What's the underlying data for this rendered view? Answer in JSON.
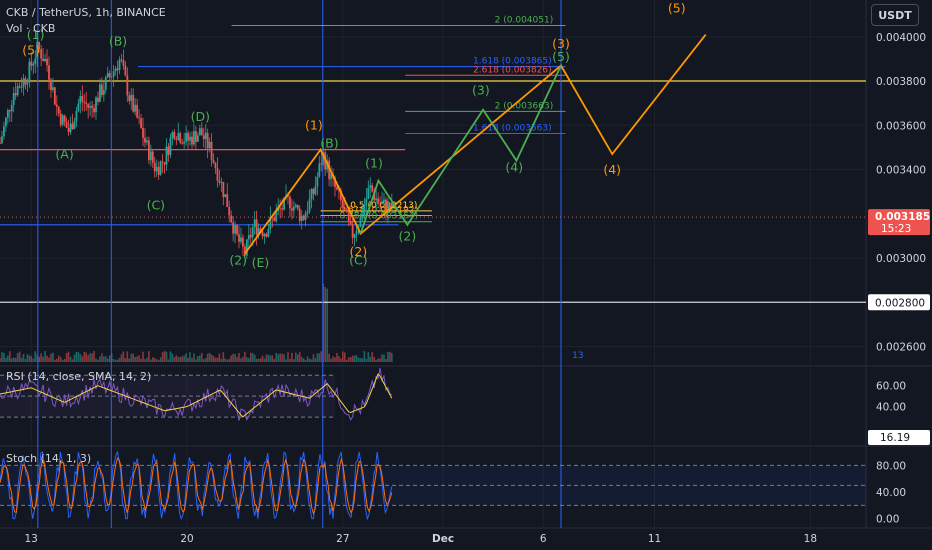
{
  "header": {
    "symbol": "CKB / TetherUS, 1h, BINANCE",
    "volume": "Vol · CKB",
    "rsi": "RSI (14, close, SMA, 14, 2)",
    "stoch": "Stoch (14, 1, 3)"
  },
  "currency_button": "USDT",
  "colors": {
    "bg": "#131722",
    "grid": "#1e222d",
    "text": "#d1d4dc",
    "up": "#26a69a",
    "down": "#ef5350",
    "green_wave": "#4caf50",
    "orange_wave": "#ff9800",
    "blue": "#2962ff",
    "red": "#ef5350",
    "yellow": "#f5d442",
    "rsi": "#7e57c2",
    "rsi_ma": "#f5d442",
    "stoch_k": "#2962ff",
    "stoch_d": "#ff6d00"
  },
  "price_labels": [
    {
      "text": "0.004000",
      "value": 0.004
    },
    {
      "text": "0.003800",
      "value": 0.0038
    },
    {
      "text": "0.003600",
      "value": 0.0036
    },
    {
      "text": "0.003400",
      "value": 0.0034
    },
    {
      "text": "0.003000",
      "value": 0.003
    },
    {
      "text": "0.002600",
      "value": 0.0026
    }
  ],
  "current_price": {
    "value": 0.003185,
    "text": "0.003185",
    "countdown": "15:23"
  },
  "marked_price": {
    "value": 0.0028,
    "text": "0.002800"
  },
  "time_labels": [
    {
      "text": "13",
      "day": 13
    },
    {
      "text": "20",
      "day": 20
    },
    {
      "text": "27",
      "day": 27
    },
    {
      "text": "Dec",
      "day": 31.5
    },
    {
      "text": "6",
      "day": 36
    },
    {
      "text": "11",
      "day": 41
    },
    {
      "text": "18",
      "day": 48
    }
  ],
  "rsi_labels": [
    "60.00",
    "40.00",
    "20.00"
  ],
  "rsi_value": "16.19",
  "stoch_labels": [
    "80.00",
    "40.00",
    "0.00"
  ],
  "chart_data": {
    "type": "line",
    "title": "CKB / TetherUS, 1h, BINANCE",
    "x_unit": "day of month (Nov, continuing into Dec)",
    "xlim": [
      11.6,
      50.5
    ],
    "ylim": [
      0.00253,
      0.00413
    ],
    "price_path": [
      [
        11.6,
        0.00352
      ],
      [
        12.2,
        0.00375
      ],
      [
        12.8,
        0.00382
      ],
      [
        13.3,
        0.00395
      ],
      [
        13.7,
        0.00388
      ],
      [
        14.2,
        0.00366
      ],
      [
        14.7,
        0.00357
      ],
      [
        15.2,
        0.00372
      ],
      [
        15.7,
        0.00367
      ],
      [
        16.1,
        0.00375
      ],
      [
        16.6,
        0.00383
      ],
      [
        17.0,
        0.0039
      ],
      [
        17.4,
        0.00373
      ],
      [
        17.8,
        0.00362
      ],
      [
        18.2,
        0.0035
      ],
      [
        18.6,
        0.0034
      ],
      [
        19.0,
        0.00345
      ],
      [
        19.4,
        0.00358
      ],
      [
        20.0,
        0.00353
      ],
      [
        20.6,
        0.00357
      ],
      [
        21.0,
        0.0035
      ],
      [
        21.4,
        0.00338
      ],
      [
        21.8,
        0.00325
      ],
      [
        22.2,
        0.0031
      ],
      [
        22.6,
        0.00302
      ],
      [
        23.0,
        0.00315
      ],
      [
        23.5,
        0.00312
      ],
      [
        24.0,
        0.0032
      ],
      [
        24.6,
        0.00326
      ],
      [
        25.2,
        0.00318
      ],
      [
        25.7,
        0.0033
      ],
      [
        26.1,
        0.00347
      ],
      [
        26.5,
        0.00335
      ],
      [
        27.0,
        0.00323
      ],
      [
        27.4,
        0.0031
      ],
      [
        27.8,
        0.00318
      ],
      [
        28.2,
        0.00332
      ],
      [
        28.6,
        0.00325
      ],
      [
        29.2,
        0.00322
      ]
    ],
    "horizontal_levels": [
      {
        "value": 0.0038,
        "color": "yellow",
        "x_from": 11.6,
        "x_to": 50.5
      },
      {
        "value": 0.00349,
        "color": "red",
        "x_from": 11.6,
        "x_to": 29.8
      },
      {
        "value": 0.00315,
        "color": "blue",
        "x_from": 11.6,
        "x_to": 29.5
      },
      {
        "value": 0.0028,
        "color": "white",
        "x_from": 11.6,
        "x_to": 50.5
      }
    ],
    "vertical_lines": [
      13.3,
      16.6,
      26.1,
      36.8
    ],
    "vertical_label": {
      "text": "13",
      "x": 37.3
    },
    "fib_levels": [
      {
        "text": "2 (0.004051)",
        "value": 0.004051,
        "x_from": 22.0,
        "x_to": 37.0,
        "color": "green_wave"
      },
      {
        "text": "1.618 (0.003865)",
        "value": 0.003865,
        "x_from": 17.8,
        "x_to": 37.0,
        "color": "blue"
      },
      {
        "text": "2.618 (0.003826)",
        "value": 0.003826,
        "x_from": 29.8,
        "x_to": 37.0,
        "color": "red"
      },
      {
        "text": "2 (0.003663)",
        "value": 0.003663,
        "x_from": 29.8,
        "x_to": 37.0,
        "color": "green_wave"
      },
      {
        "text": "1.618 (0.003563)",
        "value": 0.003563,
        "x_from": 29.8,
        "x_to": 37.0,
        "color": "blue"
      },
      {
        "text": "0.5 (0.003213)",
        "value": 0.003213,
        "x_from": 26.0,
        "x_to": 31.0,
        "color": "yellow"
      },
      {
        "text": "0.618 (0.003192)",
        "value": 0.003192,
        "x_from": 26.0,
        "x_to": 31.0,
        "color": "orange_wave"
      },
      {
        "text": "0.786 (0.003164)",
        "value": 0.003164,
        "x_from": 26.0,
        "x_to": 31.0,
        "color": "green_wave"
      }
    ],
    "series": [
      {
        "name": "",
        "color": "orange_wave",
        "x": [
          22.6,
          26.0,
          27.8,
          36.8,
          39.1,
          43.3
        ],
        "y": [
          0.00302,
          0.00349,
          0.00311,
          0.00387,
          0.00347,
          0.00401
        ]
      },
      {
        "name": "",
        "color": "green_wave",
        "x": [
          27.8,
          28.6,
          29.9,
          33.3,
          34.8,
          36.8
        ],
        "y": [
          0.00311,
          0.00335,
          0.00315,
          0.00367,
          0.00344,
          0.00387
        ]
      }
    ],
    "wave_labels": [
      {
        "text": "(1)",
        "x": 13.2,
        "y": 0.00399,
        "color": "green_wave"
      },
      {
        "text": "(5)",
        "x": 13.0,
        "y": 0.00392,
        "color": "orange_wave"
      },
      {
        "text": "(B)",
        "x": 16.9,
        "y": 0.00396,
        "color": "green_wave"
      },
      {
        "text": "(A)",
        "x": 14.5,
        "y": 0.00345,
        "color": "green_wave"
      },
      {
        "text": "(D)",
        "x": 20.6,
        "y": 0.00362,
        "color": "green_wave"
      },
      {
        "text": "(C)",
        "x": 18.6,
        "y": 0.00322,
        "color": "green_wave"
      },
      {
        "text": "(2)",
        "x": 22.3,
        "y": 0.00297,
        "color": "green_wave"
      },
      {
        "text": "(E)",
        "x": 23.3,
        "y": 0.00296,
        "color": "green_wave"
      },
      {
        "text": "(1)",
        "x": 25.7,
        "y": 0.00358,
        "color": "orange_wave"
      },
      {
        "text": "(B)",
        "x": 26.4,
        "y": 0.0035,
        "color": "green_wave"
      },
      {
        "text": "(1)",
        "x": 28.4,
        "y": 0.00341,
        "color": "green_wave"
      },
      {
        "text": "(2)",
        "x": 27.7,
        "y": 0.00301,
        "color": "orange_wave"
      },
      {
        "text": "(C)",
        "x": 27.7,
        "y": 0.00297,
        "color": "green_wave"
      },
      {
        "text": "(2)",
        "x": 29.9,
        "y": 0.00308,
        "color": "green_wave"
      },
      {
        "text": "(3)",
        "x": 33.2,
        "y": 0.00374,
        "color": "green_wave"
      },
      {
        "text": "(4)",
        "x": 34.7,
        "y": 0.00339,
        "color": "green_wave"
      },
      {
        "text": "(3)",
        "x": 36.8,
        "y": 0.00395,
        "color": "orange_wave"
      },
      {
        "text": "(5)",
        "x": 36.8,
        "y": 0.00389,
        "color": "green_wave"
      },
      {
        "text": "(4)",
        "x": 39.1,
        "y": 0.00338,
        "color": "orange_wave"
      },
      {
        "text": "(5)",
        "x": 42.0,
        "y": 0.00411,
        "color": "orange_wave"
      }
    ],
    "rsi": {
      "ylim": [
        10,
        75
      ],
      "bands": [
        70,
        50,
        30
      ],
      "anchors": [
        [
          11.6,
          52
        ],
        [
          13.0,
          58
        ],
        [
          14.5,
          44
        ],
        [
          16.0,
          60
        ],
        [
          17.5,
          48
        ],
        [
          19.0,
          36
        ],
        [
          20.0,
          40
        ],
        [
          21.5,
          56
        ],
        [
          22.5,
          30
        ],
        [
          24.0,
          56
        ],
        [
          25.5,
          48
        ],
        [
          26.3,
          62
        ],
        [
          27.3,
          34
        ],
        [
          28.0,
          40
        ],
        [
          28.6,
          72
        ],
        [
          29.2,
          48
        ]
      ]
    },
    "stoch": {
      "ylim": [
        -5,
        100
      ],
      "bands": [
        80,
        50,
        20
      ]
    }
  }
}
